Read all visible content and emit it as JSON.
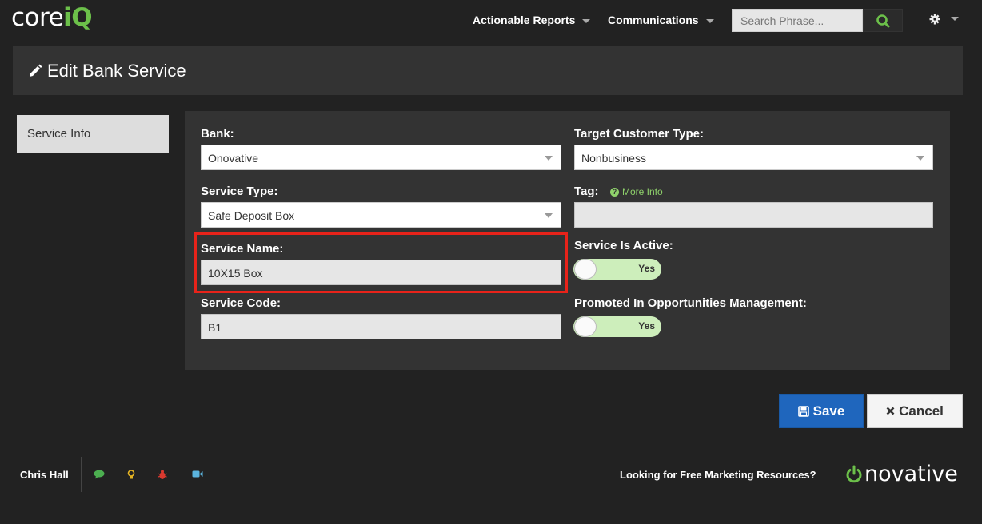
{
  "app": {
    "logo_core": "core",
    "logo_iq": "iQ"
  },
  "nav": {
    "items": [
      {
        "label": "Actionable Reports"
      },
      {
        "label": "Communications"
      }
    ],
    "search_placeholder": "Search Phrase..."
  },
  "header": {
    "title": "Edit Bank Service"
  },
  "sidebar": {
    "tab_label": "Service Info"
  },
  "form": {
    "bank": {
      "label": "Bank:",
      "value": "Onovative"
    },
    "target_customer_type": {
      "label": "Target Customer Type:",
      "value": "Nonbusiness"
    },
    "service_type": {
      "label": "Service Type:",
      "value": "Safe Deposit Box"
    },
    "tag": {
      "label": "Tag:",
      "more_info": "More Info",
      "value": ""
    },
    "service_name": {
      "label": "Service Name:",
      "value": "10X15 Box"
    },
    "service_is_active": {
      "label": "Service Is Active:",
      "value": "Yes"
    },
    "service_code": {
      "label": "Service Code:",
      "value": "B1"
    },
    "promoted": {
      "label": "Promoted In Opportunities Management:",
      "value": "Yes"
    }
  },
  "actions": {
    "save_label": "Save",
    "cancel_label": "Cancel"
  },
  "footer": {
    "user": "Chris Hall",
    "marketing_link": "Looking for Free Marketing Resources?",
    "brand": "novative",
    "icons": [
      "chat-icon",
      "lightbulb-icon",
      "bug-icon",
      "video-icon"
    ]
  },
  "colors": {
    "accent_green": "#6cc04a",
    "save_blue": "#1f66bd",
    "highlight_red": "#e8231a",
    "toggle_green": "#cdeebb"
  }
}
